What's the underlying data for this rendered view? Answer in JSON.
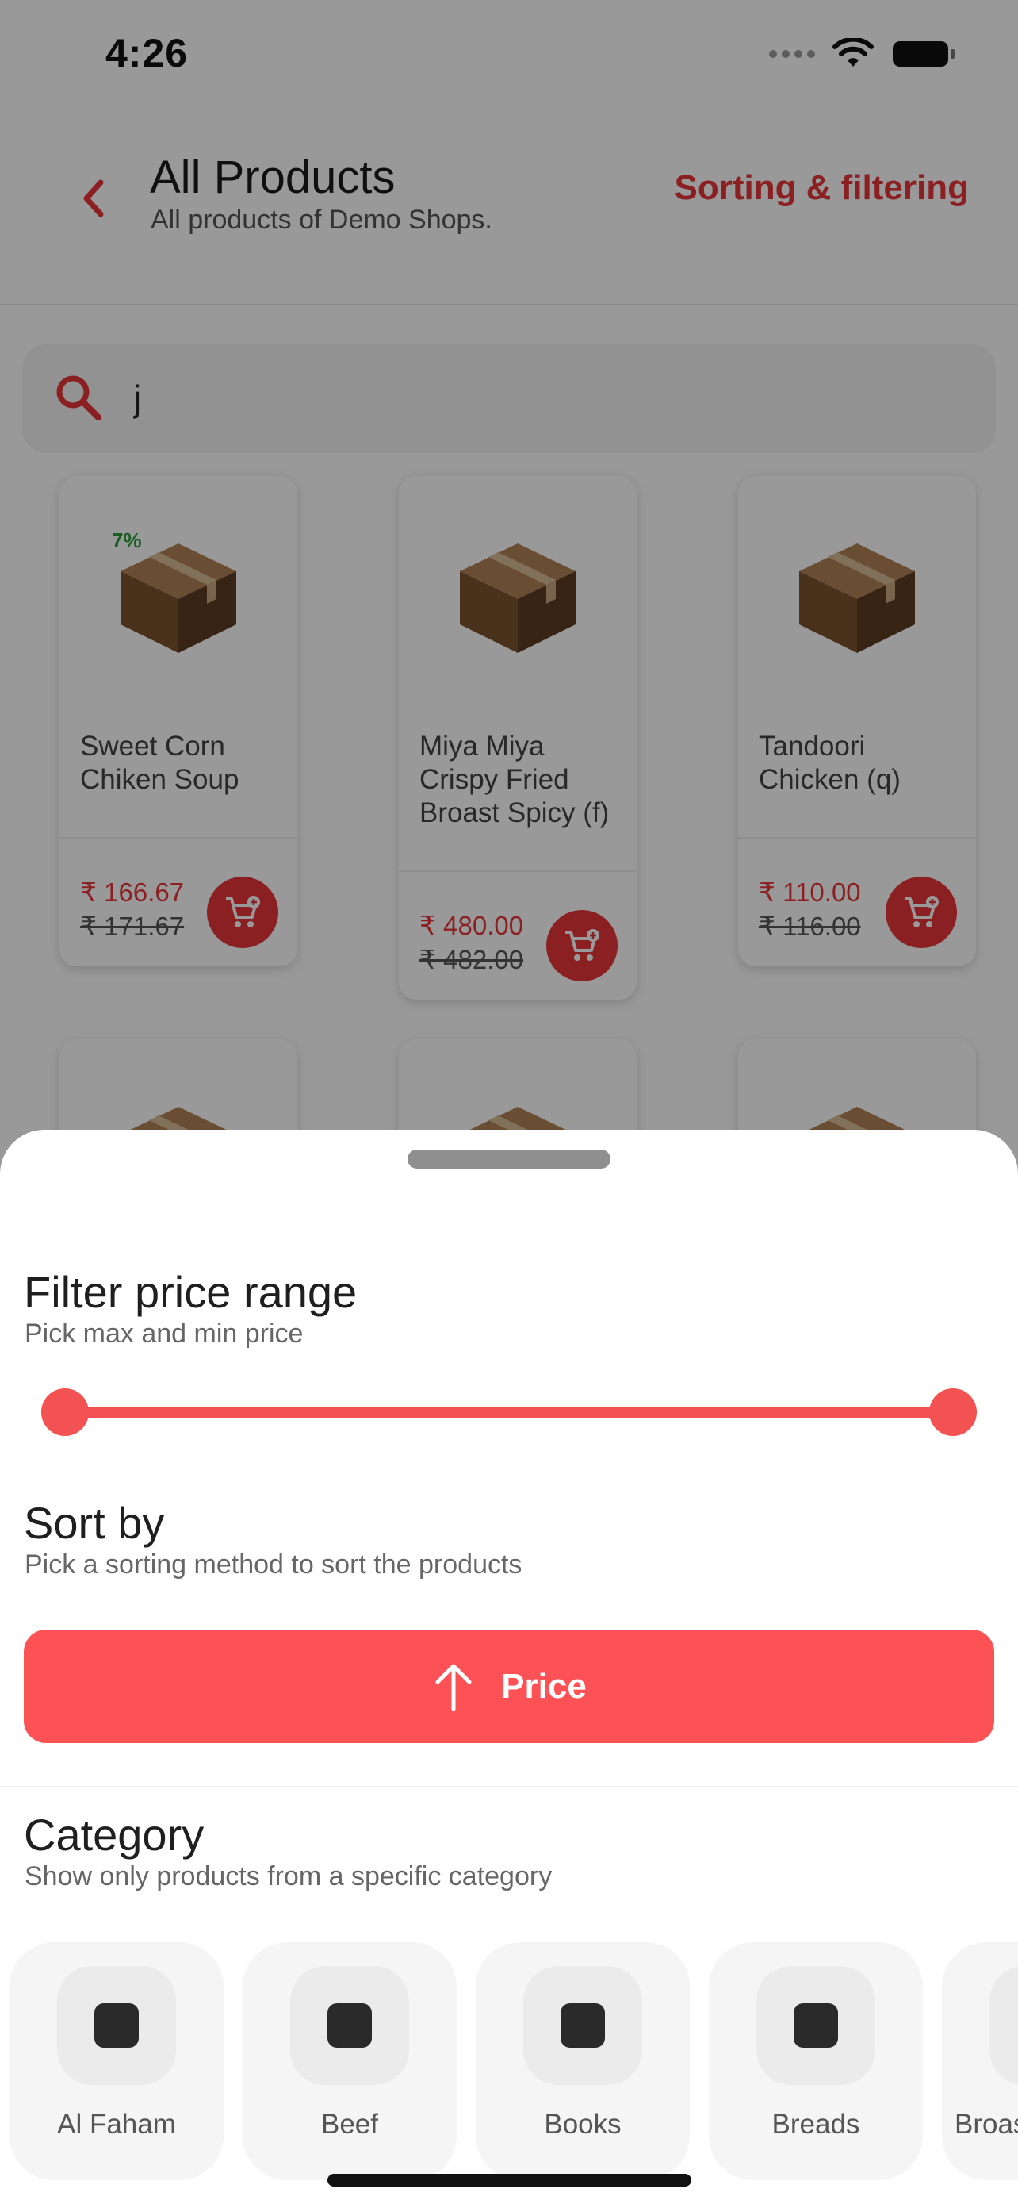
{
  "status_bar": {
    "time": "4:26"
  },
  "header": {
    "title": "All Products",
    "subtitle": "All products of Demo Shops.",
    "action_label": "Sorting & filtering"
  },
  "search": {
    "value": "j"
  },
  "products": [
    {
      "name": "Sweet Corn Chiken Soup",
      "price": "₹ 166.67",
      "old_price": "₹ 171.67",
      "discount": "7%"
    },
    {
      "name": "Miya Miya Crispy Fried Broast Spicy (f)",
      "price": "₹ 480.00",
      "old_price": "₹ 482.00",
      "discount": ""
    },
    {
      "name": "Tandoori Chicken (q)",
      "price": "₹ 110.00",
      "old_price": "₹ 116.00",
      "discount": ""
    }
  ],
  "sheet": {
    "price_range": {
      "title": "Filter price range",
      "subtitle": "Pick max and min price",
      "min_fraction": 0,
      "max_fraction": 1
    },
    "sort": {
      "title": "Sort by",
      "subtitle": "Pick a sorting method to sort the products",
      "button_label": "Price",
      "direction_icon": "arrow-up-icon"
    },
    "category": {
      "title": "Category",
      "subtitle": "Show only products from a specific category",
      "items": [
        {
          "label": "Al Faham"
        },
        {
          "label": "Beef"
        },
        {
          "label": "Books"
        },
        {
          "label": "Breads"
        },
        {
          "label": "Broas"
        }
      ]
    }
  },
  "colors": {
    "accent": "#e8363b",
    "sort_button": "#fc5155",
    "slider": "#f25252",
    "discount": "#2e9c3f"
  }
}
